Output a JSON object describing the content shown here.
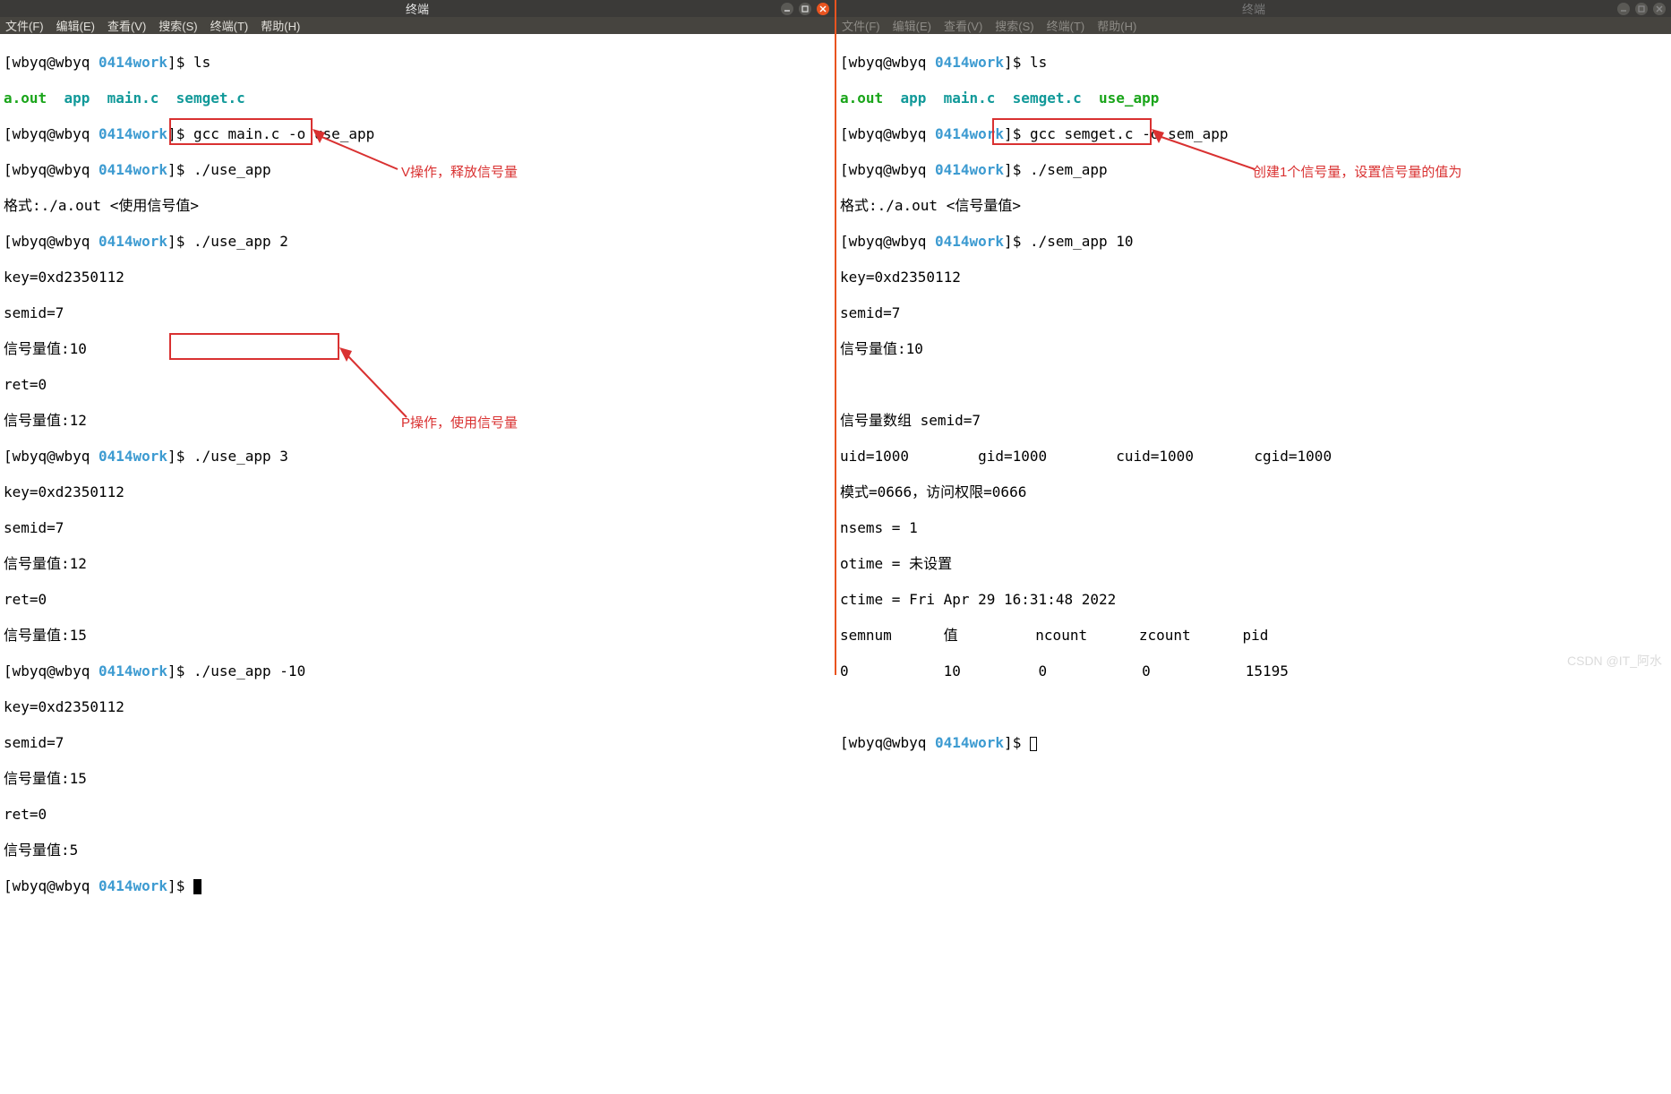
{
  "window_title": "终端",
  "menu": [
    "文件(F)",
    "编辑(E)",
    "查看(V)",
    "搜索(S)",
    "终端(T)",
    "帮助(H)"
  ],
  "prompt": {
    "user": "wbyq",
    "host": "wbyq",
    "dir": "0414work",
    "symbol": "$"
  },
  "left": {
    "ls_out": {
      "a_out": "a.out",
      "app": "app",
      "main": "main.c",
      "semget": "semget.c"
    },
    "cmds": {
      "ls": "ls",
      "gcc": "gcc main.c -o use_app",
      "run1": "./use_app",
      "usage": "格式:./a.out <使用信号值>",
      "run2": "./use_app 2",
      "run3": "./use_app 3",
      "run4": "./use_app -10"
    },
    "out": {
      "key": "key=0xd2350112",
      "semid": "semid=7",
      "val10": "信号量值:10",
      "ret0": "ret=0",
      "val12": "信号量值:12",
      "val15": "信号量值:15",
      "val5": "信号量值:5"
    }
  },
  "right": {
    "ls_out": {
      "a_out": "a.out",
      "app": "app",
      "main": "main.c",
      "semget": "semget.c",
      "use_app": "use_app"
    },
    "cmds": {
      "ls": "ls",
      "gcc": "gcc semget.c -o sem_app",
      "run1": "./sem_app",
      "usage": "格式:./a.out <信号量值>",
      "run2": "./sem_app 10"
    },
    "out": {
      "key": "key=0xd2350112",
      "semid": "semid=7",
      "val10": "信号量值:10",
      "arrhdr": "信号量数组 semid=7",
      "ids": "uid=1000        gid=1000        cuid=1000       cgid=1000",
      "mode": "模式=0666，访问权限=0666",
      "nsems": "nsems = 1",
      "otime": "otime = 未设置",
      "ctime": "ctime = Fri Apr 29 16:31:48 2022",
      "tblhdr": "semnum      值         ncount      zcount      pid",
      "tblrow": "0           10         0           0           15195"
    }
  },
  "annotations": {
    "v_op": "V操作，释放信号量",
    "p_op": "P操作，使用信号量",
    "create": "创建1个信号量，设置信号量的值为"
  },
  "watermark": "CSDN @IT_阿水"
}
